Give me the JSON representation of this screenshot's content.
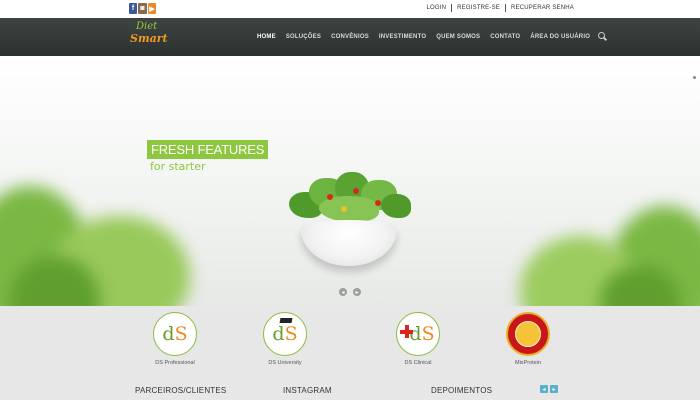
{
  "social": [
    {
      "glyph": "f",
      "icon": "facebook-icon"
    },
    {
      "glyph": "◙",
      "icon": "instagram-icon"
    },
    {
      "glyph": "▶",
      "icon": "youtube-icon"
    }
  ],
  "top_links": [
    "LOGIN",
    "REGISTRE-SE",
    "RECUPERAR SENHA"
  ],
  "logo": {
    "line1": "Diet",
    "line2": "Smart"
  },
  "menu": [
    "HOME",
    "SOLUÇÕES",
    "CONVÊNIOS",
    "INVESTIMENTO",
    "QUEM SOMOS",
    "CONTATO",
    "ÁREA DO USUÁRIO"
  ],
  "hero": {
    "title": "FRESH FEATURES",
    "subtitle": "for starter",
    "prev": "◂",
    "next": "▸"
  },
  "brands": {
    "professional": {
      "d": "d",
      "s": "S",
      "caption": "DS Professional"
    },
    "university": {
      "d": "d",
      "s": "S",
      "caption": "DS University"
    },
    "clinical": {
      "d": "d",
      "s": "S",
      "caption": "DS Clinical"
    },
    "mixprotein": {
      "caption": "MixProtein"
    }
  },
  "sections": {
    "partners": "PARCEIROS/CLIENTES",
    "instagram": "INSTAGRAM",
    "testimonials": "DEPOIMENTOS",
    "prev": "◂",
    "next": "▸"
  },
  "colors": {
    "accent_green": "#8dc63f",
    "nav_bg": "#2c3230",
    "brand_orange": "#f29a1e",
    "arrow_blue": "#58b0c9"
  }
}
